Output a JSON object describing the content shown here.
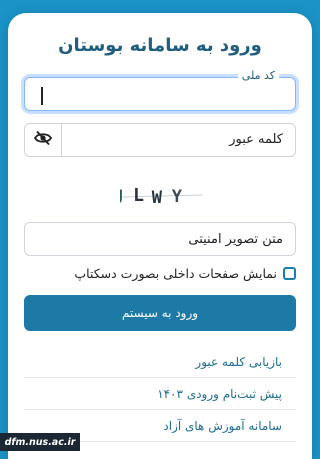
{
  "form": {
    "title": "ورود به سامانه بوستان",
    "national_id_label": "کد ملی",
    "national_id_value": "",
    "password_placeholder": "کلمه عبور",
    "captcha_image_text": "JLWY",
    "captcha_placeholder": "متن تصویر امنیتی",
    "checkbox_label": "نمایش صفحات داخلی بصورت دسکتاپ",
    "login_button": "ورود به سیستم"
  },
  "links": [
    {
      "label": "بازیابی کلمه عبور"
    },
    {
      "label": "پیش ثبت‌نام ورودی ۱۴۰۳"
    },
    {
      "label": "سامانه آموزش های آزاد"
    }
  ],
  "watermark": "dfm.nus.ac.ir",
  "colors": {
    "accent": "#1d7aa6",
    "background": "#1b93c7",
    "title": "#1f5e7e"
  },
  "icons": {
    "password_toggle": "eye-slash-icon"
  }
}
